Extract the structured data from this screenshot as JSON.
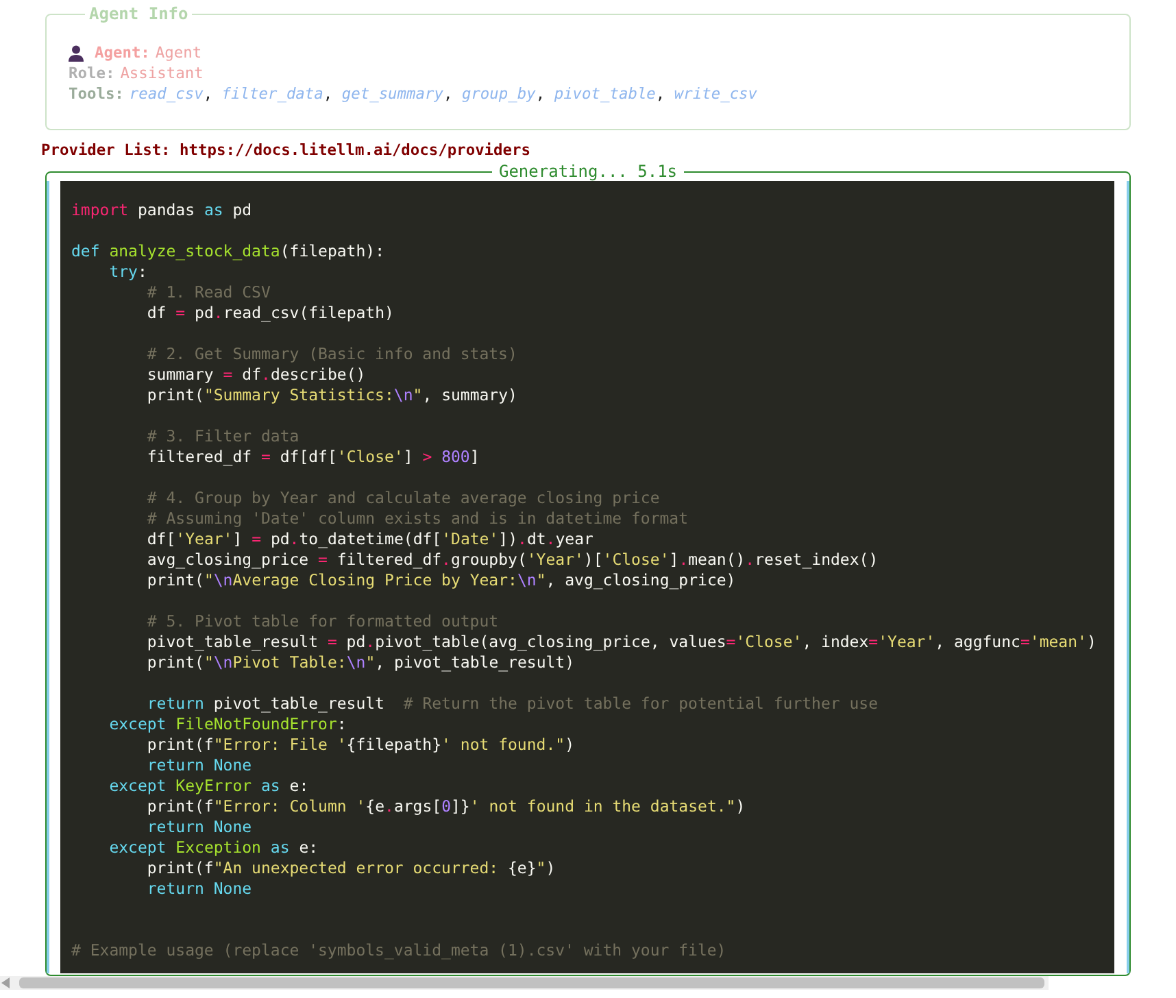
{
  "agent_info": {
    "title": "Agent Info",
    "agent": {
      "label": "Agent:",
      "value": "Agent"
    },
    "role": {
      "label": "Role:",
      "value": "Assistant"
    },
    "tools": {
      "label": "Tools:",
      "value": "*read_csv*, *filter_data*, *get_summary*, *group_by*, *pivot_table*, *write_csv*"
    }
  },
  "provider_list": {
    "label": "Provider List:",
    "url": "https://docs.litellm.ai/docs/providers"
  },
  "generating": {
    "status": "Generating... 5.1s"
  },
  "code_lines": [
    {
      "kind": "code",
      "tokens": [
        {
          "text": "import",
          "kind": "kw"
        },
        {
          "text": " pandas ",
          "kind": "txt"
        },
        {
          "text": "as",
          "kind": "decl"
        },
        {
          "text": " pd",
          "kind": "txt"
        }
      ]
    },
    {
      "kind": "blank"
    },
    {
      "kind": "code",
      "tokens": [
        {
          "text": "def",
          "kind": "decl"
        },
        {
          "text": " analyze_stock_data",
          "kind": "fn"
        },
        {
          "text": "(filepath):",
          "kind": "txt"
        }
      ]
    },
    {
      "kind": "code",
      "tokens": [
        {
          "text": "    try",
          "kind": "decl"
        },
        {
          "text": ":",
          "kind": "txt"
        }
      ]
    },
    {
      "kind": "code",
      "tokens": [
        {
          "text": "        # 1. Read CSV",
          "kind": "com"
        }
      ]
    },
    {
      "kind": "code",
      "tokens": [
        {
          "text": "        df ",
          "kind": "txt"
        },
        {
          "text": "=",
          "kind": "op"
        },
        {
          "text": " pd",
          "kind": "txt"
        },
        {
          "text": ".",
          "kind": "op"
        },
        {
          "text": "read_csv(filepath)",
          "kind": "txt"
        }
      ]
    },
    {
      "kind": "blank"
    },
    {
      "kind": "code",
      "tokens": [
        {
          "text": "        # 2. Get Summary (Basic info and stats)",
          "kind": "com"
        }
      ]
    },
    {
      "kind": "code",
      "tokens": [
        {
          "text": "        summary ",
          "kind": "txt"
        },
        {
          "text": "=",
          "kind": "op"
        },
        {
          "text": " df",
          "kind": "txt"
        },
        {
          "text": ".",
          "kind": "op"
        },
        {
          "text": "describe()",
          "kind": "txt"
        }
      ]
    },
    {
      "kind": "code",
      "tokens": [
        {
          "text": "        print(",
          "kind": "txt"
        },
        {
          "text": "\"Summary Statistics:",
          "kind": "str"
        },
        {
          "text": "\\n",
          "kind": "esc"
        },
        {
          "text": "\"",
          "kind": "str"
        },
        {
          "text": ", summary)",
          "kind": "txt"
        }
      ]
    },
    {
      "kind": "blank"
    },
    {
      "kind": "code",
      "tokens": [
        {
          "text": "        # 3. Filter data",
          "kind": "com"
        }
      ]
    },
    {
      "kind": "code",
      "tokens": [
        {
          "text": "        filtered_df ",
          "kind": "txt"
        },
        {
          "text": "=",
          "kind": "op"
        },
        {
          "text": " df[df[",
          "kind": "txt"
        },
        {
          "text": "'Close'",
          "kind": "str"
        },
        {
          "text": "] ",
          "kind": "txt"
        },
        {
          "text": ">",
          "kind": "op"
        },
        {
          "text": " 800",
          "kind": "num"
        },
        {
          "text": "]",
          "kind": "txt"
        }
      ]
    },
    {
      "kind": "blank"
    },
    {
      "kind": "code",
      "tokens": [
        {
          "text": "        # 4. Group by Year and calculate average closing price",
          "kind": "com"
        }
      ]
    },
    {
      "kind": "code",
      "tokens": [
        {
          "text": "        # Assuming 'Date' column exists and is in datetime format",
          "kind": "com"
        }
      ]
    },
    {
      "kind": "code",
      "tokens": [
        {
          "text": "        df[",
          "kind": "txt"
        },
        {
          "text": "'Year'",
          "kind": "str"
        },
        {
          "text": "] ",
          "kind": "txt"
        },
        {
          "text": "=",
          "kind": "op"
        },
        {
          "text": " pd",
          "kind": "txt"
        },
        {
          "text": ".",
          "kind": "op"
        },
        {
          "text": "to_datetime(df[",
          "kind": "txt"
        },
        {
          "text": "'Date'",
          "kind": "str"
        },
        {
          "text": "])",
          "kind": "txt"
        },
        {
          "text": ".",
          "kind": "op"
        },
        {
          "text": "dt",
          "kind": "txt"
        },
        {
          "text": ".",
          "kind": "op"
        },
        {
          "text": "year",
          "kind": "txt"
        }
      ]
    },
    {
      "kind": "code",
      "tokens": [
        {
          "text": "        avg_closing_price ",
          "kind": "txt"
        },
        {
          "text": "=",
          "kind": "op"
        },
        {
          "text": " filtered_df",
          "kind": "txt"
        },
        {
          "text": ".",
          "kind": "op"
        },
        {
          "text": "groupby(",
          "kind": "txt"
        },
        {
          "text": "'Year'",
          "kind": "str"
        },
        {
          "text": ")[",
          "kind": "txt"
        },
        {
          "text": "'Close'",
          "kind": "str"
        },
        {
          "text": "]",
          "kind": "txt"
        },
        {
          "text": ".",
          "kind": "op"
        },
        {
          "text": "mean()",
          "kind": "txt"
        },
        {
          "text": ".",
          "kind": "op"
        },
        {
          "text": "reset_index()",
          "kind": "txt"
        }
      ]
    },
    {
      "kind": "code",
      "tokens": [
        {
          "text": "        print(",
          "kind": "txt"
        },
        {
          "text": "\"",
          "kind": "str"
        },
        {
          "text": "\\n",
          "kind": "esc"
        },
        {
          "text": "Average Closing Price by Year:",
          "kind": "str"
        },
        {
          "text": "\\n",
          "kind": "esc"
        },
        {
          "text": "\"",
          "kind": "str"
        },
        {
          "text": ", avg_closing_price)",
          "kind": "txt"
        }
      ]
    },
    {
      "kind": "blank"
    },
    {
      "kind": "code",
      "tokens": [
        {
          "text": "        # 5. Pivot table for formatted output",
          "kind": "com"
        }
      ]
    },
    {
      "kind": "code",
      "tokens": [
        {
          "text": "        pivot_table_result ",
          "kind": "txt"
        },
        {
          "text": "=",
          "kind": "op"
        },
        {
          "text": " pd",
          "kind": "txt"
        },
        {
          "text": ".",
          "kind": "op"
        },
        {
          "text": "pivot_table(avg_closing_price, values",
          "kind": "txt"
        },
        {
          "text": "=",
          "kind": "op"
        },
        {
          "text": "'Close'",
          "kind": "str"
        },
        {
          "text": ", index",
          "kind": "txt"
        },
        {
          "text": "=",
          "kind": "op"
        },
        {
          "text": "'Year'",
          "kind": "str"
        },
        {
          "text": ", aggfunc",
          "kind": "txt"
        },
        {
          "text": "=",
          "kind": "op"
        },
        {
          "text": "'mean'",
          "kind": "str"
        },
        {
          "text": ")",
          "kind": "txt"
        }
      ]
    },
    {
      "kind": "code",
      "tokens": [
        {
          "text": "        print(",
          "kind": "txt"
        },
        {
          "text": "\"",
          "kind": "str"
        },
        {
          "text": "\\n",
          "kind": "esc"
        },
        {
          "text": "Pivot Table:",
          "kind": "str"
        },
        {
          "text": "\\n",
          "kind": "esc"
        },
        {
          "text": "\"",
          "kind": "str"
        },
        {
          "text": ", pivot_table_result)",
          "kind": "txt"
        }
      ]
    },
    {
      "kind": "blank"
    },
    {
      "kind": "code",
      "tokens": [
        {
          "text": "        return",
          "kind": "decl"
        },
        {
          "text": " pivot_table_result  ",
          "kind": "txt"
        },
        {
          "text": "# Return the pivot table for potential further use",
          "kind": "com"
        }
      ]
    },
    {
      "kind": "code",
      "tokens": [
        {
          "text": "    except",
          "kind": "decl"
        },
        {
          "text": " FileNotFoundError",
          "kind": "fn"
        },
        {
          "text": ":",
          "kind": "txt"
        }
      ]
    },
    {
      "kind": "code",
      "tokens": [
        {
          "text": "        print(f",
          "kind": "txt"
        },
        {
          "text": "\"Error: File '",
          "kind": "str"
        },
        {
          "text": "{filepath}",
          "kind": "txt"
        },
        {
          "text": "' not found.\"",
          "kind": "str"
        },
        {
          "text": ")",
          "kind": "txt"
        }
      ]
    },
    {
      "kind": "code",
      "tokens": [
        {
          "text": "        return",
          "kind": "decl"
        },
        {
          "text": " None",
          "kind": "decl"
        }
      ]
    },
    {
      "kind": "code",
      "tokens": [
        {
          "text": "    except",
          "kind": "decl"
        },
        {
          "text": " KeyError",
          "kind": "fn"
        },
        {
          "text": " as",
          "kind": "decl"
        },
        {
          "text": " e:",
          "kind": "txt"
        }
      ]
    },
    {
      "kind": "code",
      "tokens": [
        {
          "text": "        print(f",
          "kind": "txt"
        },
        {
          "text": "\"Error: Column '",
          "kind": "str"
        },
        {
          "text": "{e",
          "kind": "txt"
        },
        {
          "text": ".",
          "kind": "op"
        },
        {
          "text": "args[",
          "kind": "txt"
        },
        {
          "text": "0",
          "kind": "num"
        },
        {
          "text": "]}",
          "kind": "txt"
        },
        {
          "text": "' not found in the dataset.\"",
          "kind": "str"
        },
        {
          "text": ")",
          "kind": "txt"
        }
      ]
    },
    {
      "kind": "code",
      "tokens": [
        {
          "text": "        return",
          "kind": "decl"
        },
        {
          "text": " None",
          "kind": "decl"
        }
      ]
    },
    {
      "kind": "code",
      "tokens": [
        {
          "text": "    except",
          "kind": "decl"
        },
        {
          "text": " Exception",
          "kind": "fn"
        },
        {
          "text": " as",
          "kind": "decl"
        },
        {
          "text": " e:",
          "kind": "txt"
        }
      ]
    },
    {
      "kind": "code",
      "tokens": [
        {
          "text": "        print(f",
          "kind": "txt"
        },
        {
          "text": "\"An unexpected error occurred: ",
          "kind": "str"
        },
        {
          "text": "{e}",
          "kind": "txt"
        },
        {
          "text": "\"",
          "kind": "str"
        },
        {
          "text": ")",
          "kind": "txt"
        }
      ]
    },
    {
      "kind": "code",
      "tokens": [
        {
          "text": "        return",
          "kind": "decl"
        },
        {
          "text": " None",
          "kind": "decl"
        }
      ]
    },
    {
      "kind": "blank"
    },
    {
      "kind": "blank"
    },
    {
      "kind": "code",
      "tokens": [
        {
          "text": "# Example usage (replace 'symbols_valid_meta (1).csv' with your file)",
          "kind": "com"
        }
      ]
    }
  ]
}
